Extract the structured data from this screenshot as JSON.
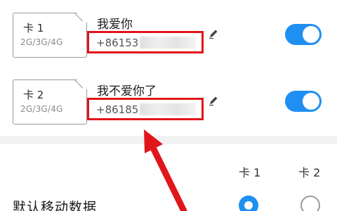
{
  "sims": [
    {
      "card_label": "卡 1",
      "network": "2G/3G/4G",
      "contact_name": "我爱你",
      "number_prefix": "+86153",
      "toggle_on": true
    },
    {
      "card_label": "卡 2",
      "network": "2G/3G/4G",
      "contact_name": "我不爱你了",
      "number_prefix": "+86185",
      "toggle_on": true
    }
  ],
  "default_data": {
    "label": "默认移动数据",
    "col1": "卡 1",
    "col2": "卡 2",
    "selected": "卡 1"
  },
  "colors": {
    "accent": "#1f8ff2",
    "highlight": "#e0161b"
  }
}
